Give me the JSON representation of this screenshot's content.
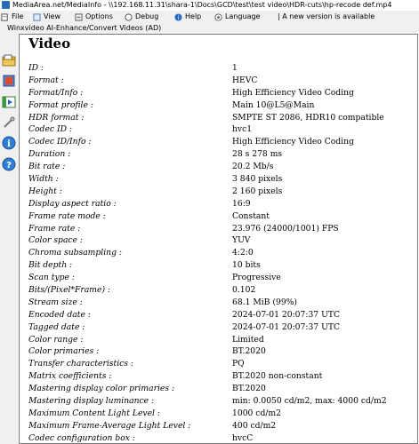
{
  "titlebar": {
    "text": "MediaArea.net/MediaInfo - \\\\192.168.11.31\\shara-1\\Docs\\GCD\\test\\test video\\HDR-cuts\\hp-recode def.mp4"
  },
  "menu": {
    "file": "File",
    "view": "View",
    "options": "Options",
    "debug": "Debug",
    "help": "Help",
    "language": "Language",
    "new_version": "| A new version is available"
  },
  "toolbar_label": "Winxvideo AI-Enhance/Convert Videos (AD)",
  "section_title": "Video",
  "rows": [
    {
      "label": "ID :",
      "value": "1"
    },
    {
      "label": "Format :",
      "value": "HEVC"
    },
    {
      "label": "Format/Info :",
      "value": "High Efficiency Video Coding"
    },
    {
      "label": "Format profile :",
      "value": "Main 10@L5@Main"
    },
    {
      "label": "HDR format :",
      "value": "SMPTE ST 2086, HDR10 compatible"
    },
    {
      "label": "Codec ID :",
      "value": "hvc1"
    },
    {
      "label": "Codec ID/Info :",
      "value": "High Efficiency Video Coding"
    },
    {
      "label": "Duration :",
      "value": "28 s 278 ms"
    },
    {
      "label": "Bit rate :",
      "value": "20.2 Mb/s"
    },
    {
      "label": "Width :",
      "value": "3 840 pixels"
    },
    {
      "label": "Height :",
      "value": "2 160 pixels"
    },
    {
      "label": "Display aspect ratio :",
      "value": "16:9"
    },
    {
      "label": "Frame rate mode :",
      "value": "Constant"
    },
    {
      "label": "Frame rate :",
      "value": "23.976 (24000/1001) FPS"
    },
    {
      "label": "Color space :",
      "value": "YUV"
    },
    {
      "label": "Chroma subsampling :",
      "value": "4:2:0"
    },
    {
      "label": "Bit depth :",
      "value": "10 bits"
    },
    {
      "label": "Scan type :",
      "value": "Progressive"
    },
    {
      "label": "Bits/(Pixel*Frame) :",
      "value": "0.102"
    },
    {
      "label": "Stream size :",
      "value": "68.1 MiB (99%)"
    },
    {
      "label": "Encoded date :",
      "value": "2024-07-01 20:07:37 UTC"
    },
    {
      "label": "Tagged date :",
      "value": "2024-07-01 20:07:37 UTC"
    },
    {
      "label": "Color range :",
      "value": "Limited"
    },
    {
      "label": "Color primaries :",
      "value": "BT.2020"
    },
    {
      "label": "Transfer characteristics :",
      "value": "PQ"
    },
    {
      "label": "Matrix coefficients :",
      "value": "BT.2020 non-constant"
    },
    {
      "label": "Mastering display color primaries :",
      "value": "BT.2020"
    },
    {
      "label": "Mastering display luminance :",
      "value": "min: 0.0050 cd/m2, max: 4000 cd/m2"
    },
    {
      "label": "Maximum Content Light Level :",
      "value": "1000 cd/m2"
    },
    {
      "label": "Maximum Frame-Average Light Level :",
      "value": "400 cd/m2"
    },
    {
      "label": "Codec configuration box :",
      "value": "hvcC"
    }
  ],
  "sidebar_icons": [
    "folder-open-icon",
    "export-icon",
    "sheet-view-icon",
    "tools-icon",
    "info-icon",
    "question-icon"
  ]
}
